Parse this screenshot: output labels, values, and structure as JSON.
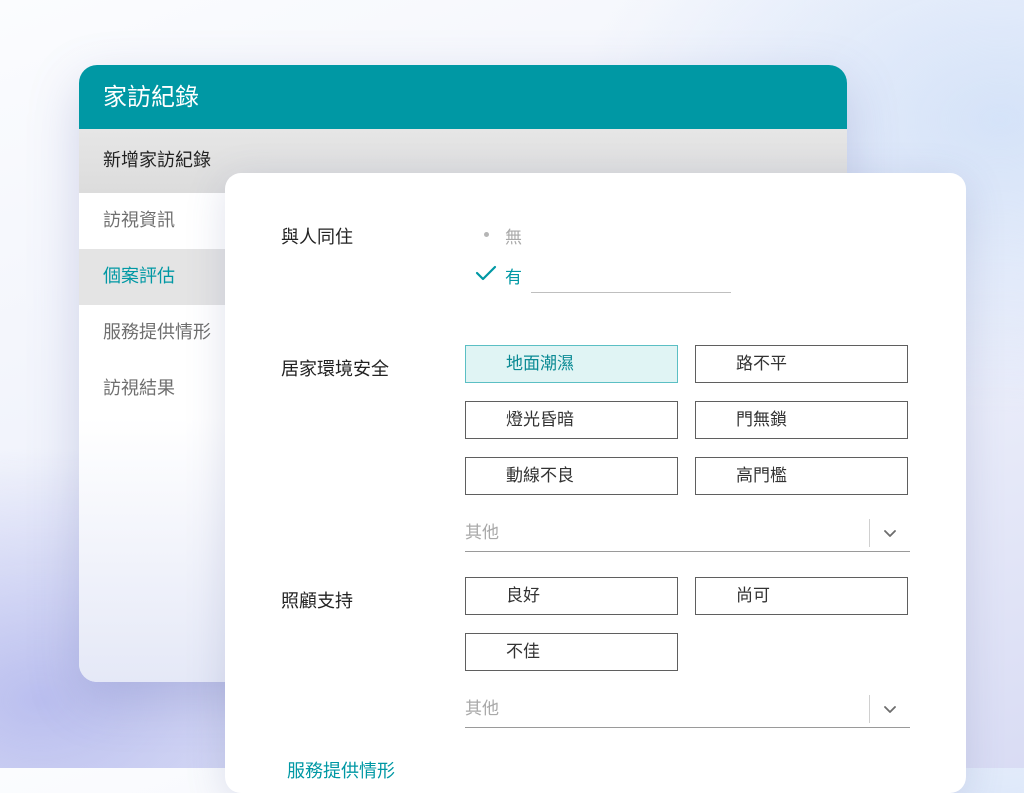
{
  "window": {
    "title": "家訪紀錄"
  },
  "sidebar": {
    "items": [
      {
        "label": "新增家訪紀錄"
      },
      {
        "label": "訪視資訊"
      },
      {
        "label": "個案評估"
      },
      {
        "label": "服務提供情形"
      },
      {
        "label": "訪視結果"
      }
    ]
  },
  "form": {
    "cohabit": {
      "label": "與人同住",
      "options": [
        {
          "label": "無",
          "selected": false
        },
        {
          "label": "有",
          "selected": true
        }
      ],
      "detail_value": ""
    },
    "home_safety": {
      "label": "居家環境安全",
      "options": [
        {
          "label": "地面潮濕",
          "selected": true
        },
        {
          "label": "路不平",
          "selected": false
        },
        {
          "label": "燈光昏暗",
          "selected": false
        },
        {
          "label": "門無鎖",
          "selected": false
        },
        {
          "label": "動線不良",
          "selected": false
        },
        {
          "label": "高門檻",
          "selected": false
        }
      ],
      "other_placeholder": "其他"
    },
    "care_support": {
      "label": "照顧支持",
      "options": [
        {
          "label": "良好",
          "selected": false
        },
        {
          "label": "尚可",
          "selected": false
        },
        {
          "label": "不佳",
          "selected": false
        }
      ],
      "other_placeholder": "其他"
    },
    "next_section_link": "服務提供情形"
  },
  "colors": {
    "accent": "#0098a4",
    "selected_bg": "#e0f4f4"
  },
  "icons": {
    "check": "check-icon",
    "dropdown": "chevron-down-icon",
    "bullet": "bullet-dot-icon"
  }
}
